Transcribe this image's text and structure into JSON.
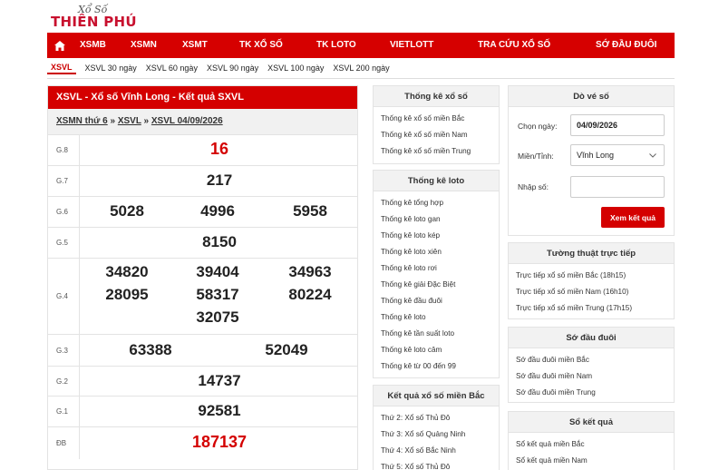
{
  "logo": {
    "small": "Xổ Số",
    "big": "THIÊN PHÚ"
  },
  "nav": {
    "home_icon": "home-icon",
    "items": [
      "XSMB",
      "XSMN",
      "XSMT",
      "TK XỔ SỐ",
      "TK LOTO",
      "VIETLOTT",
      "TRA CỨU XỔ SỐ",
      "SỚ ĐẦU ĐUÔI"
    ]
  },
  "subnav": [
    "XSVL",
    "XSVL 30 ngày",
    "XSVL 60 ngày",
    "XSVL 90 ngày",
    "XSVL 100 ngày",
    "XSVL 200 ngày"
  ],
  "result": {
    "title": "XSVL - Xổ số Vĩnh Long - Kết quả SXVL",
    "crumb": {
      "c1": "XSMN thứ 6",
      "sep": "»",
      "c2": "XSVL",
      "c3": "XSVL 04/09/2026"
    },
    "prizes": {
      "g8": {
        "label": "G.8",
        "values": [
          "16"
        ]
      },
      "g7": {
        "label": "G.7",
        "values": [
          "217"
        ]
      },
      "g6": {
        "label": "G.6",
        "values": [
          "5028",
          "4996",
          "5958"
        ]
      },
      "g5": {
        "label": "G.5",
        "values": [
          "8150"
        ]
      },
      "g4": {
        "label": "G.4",
        "values": [
          "34820",
          "39404",
          "34963",
          "28095",
          "58317",
          "80224",
          "32075"
        ]
      },
      "g3": {
        "label": "G.3",
        "values": [
          "63388",
          "52049"
        ]
      },
      "g2": {
        "label": "G.2",
        "values": [
          "14737"
        ]
      },
      "g1": {
        "label": "G.1",
        "values": [
          "92581"
        ]
      },
      "db": {
        "label": "ĐB",
        "values": [
          "187137"
        ]
      }
    }
  },
  "tk_xoso": {
    "title": "Thống kê xổ số",
    "items": [
      "Thống kê xổ số miền Bắc",
      "Thống kê xổ số miền Nam",
      "Thống kê xổ số miền Trung"
    ]
  },
  "tk_loto": {
    "title": "Thống kê loto",
    "items": [
      "Thống kê tổng hợp",
      "Thống kê loto gan",
      "Thống kê loto kép",
      "Thống kê loto xiên",
      "Thống kê loto rơi",
      "Thống kê giải Đặc Biệt",
      "Thống kê đầu đuôi",
      "Thống kê loto",
      "Thống kê tần suất loto",
      "Thống kê loto câm",
      "Thống kê từ 00 đến 99"
    ]
  },
  "kq_mb": {
    "title": "Kết quả xổ số miền Bắc",
    "items": [
      "Thứ 2: Xổ số Thủ Đô",
      "Thứ 3: Xổ số Quảng Ninh",
      "Thứ 4: Xổ số Bắc Ninh",
      "Thứ 5: Xổ số Thủ Đô"
    ]
  },
  "do_ve": {
    "title": "Dò vé số",
    "date_label": "Chọn ngày:",
    "date_value": "04/09/2026",
    "province_label": "Miền/Tỉnh:",
    "province_value": "Vĩnh Long",
    "number_label": "Nhập số:",
    "number_value": "",
    "submit": "Xem kết quả"
  },
  "tuong_thuat": {
    "title": "Tường thuật trực tiếp",
    "items": [
      "Trực tiếp xổ số miền Bắc (18h15)",
      "Trực tiếp xổ số miền Nam (16h10)",
      "Trực tiếp xổ số miền Trung (17h15)"
    ]
  },
  "so_dau_duoi": {
    "title": "Sớ đầu đuôi",
    "items": [
      "Sớ đầu đuôi miền Bắc",
      "Sớ đầu đuôi miền Nam",
      "Sớ đầu đuôi miền Trung"
    ]
  },
  "so_ket_qua": {
    "title": "Sổ kết quả",
    "items": [
      "Sổ kết quả miền Bắc",
      "Sổ kết quả miền Nam"
    ]
  }
}
